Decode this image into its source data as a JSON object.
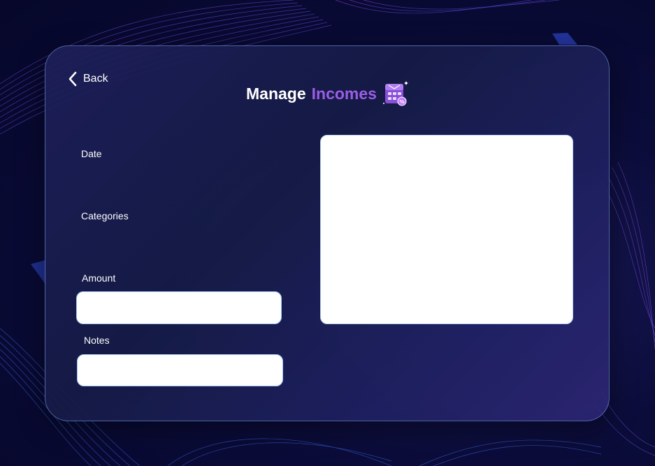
{
  "header": {
    "back_label": "Back",
    "title_part1": "Manage",
    "title_part2": "Incomes"
  },
  "form": {
    "date_label": "Date",
    "categories_label": "Categories",
    "amount_label": "Amount",
    "amount_value": "",
    "notes_label": "Notes",
    "notes_value": ""
  },
  "icons": {
    "back": "chevron-left-icon",
    "title_badge": "calculator-icon"
  },
  "colors": {
    "accent": "#9b5de5",
    "background": "#0b0c3a",
    "card": "#1e2050",
    "input_bg": "#ffffff",
    "input_border": "#9fc4f0"
  }
}
